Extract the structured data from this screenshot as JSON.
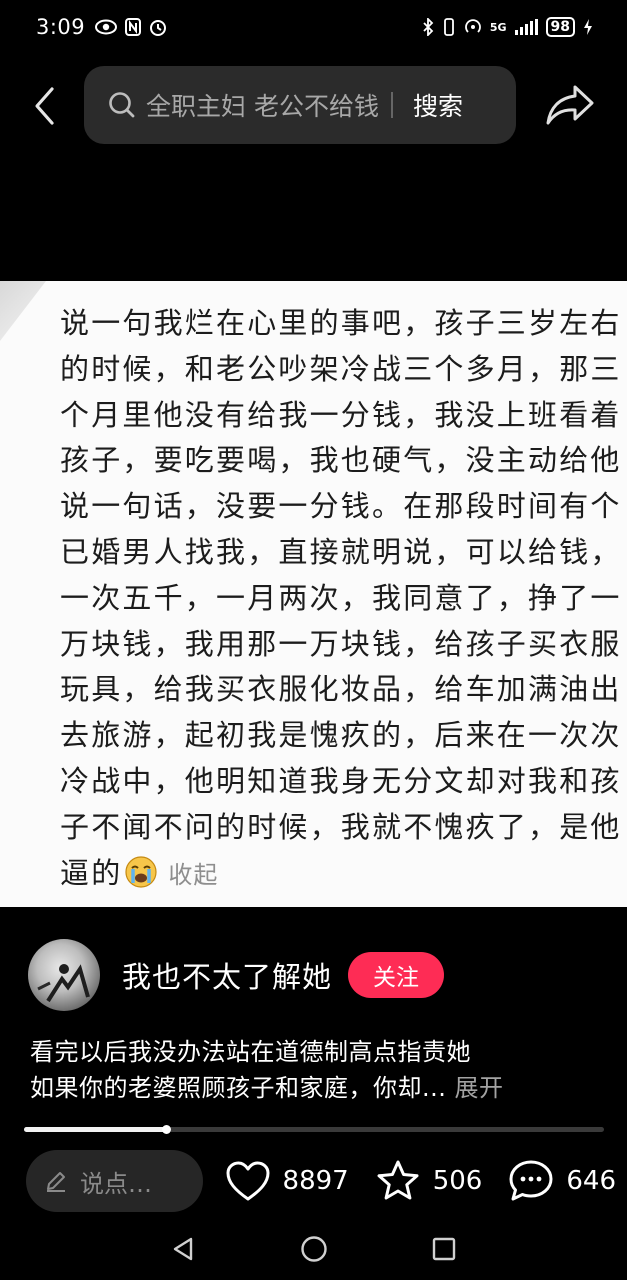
{
  "status_bar": {
    "time": "3:09",
    "network": "5G",
    "battery": "98"
  },
  "search": {
    "query": "全职主妇 老公不给钱",
    "button_label": "搜索"
  },
  "post": {
    "text": "说一句我烂在心里的事吧，孩子三岁左右的时候，和老公吵架冷战三个多月，那三个月里他没有给我一分钱，我没上班看着孩子，要吃要喝，我也硬气，没主动给他说一句话，没要一分钱。在那段时间有个已婚男人找我，直接就明说，可以给钱，一次五千，一月两次，我同意了，挣了一万块钱，我用那一万块钱，给孩子买衣服玩具，给我买衣服化妆品，给车加满油出去旅游，起初我是愧疚的，后来在一次次冷战中，他明知道我身无分文却对我和孩子不闻不问的时候，我就不愧疚了，是他逼的",
    "collapse_label": "收起",
    "emoji": "loudly-crying-face"
  },
  "author": {
    "name": "我也不太了解她",
    "follow_label": "关注"
  },
  "caption": {
    "line1": "看完以后我没办法站在道德制高点指责她",
    "line2": "如果你的老婆照顾孩子和家庭，你却...",
    "expand_label": "展开"
  },
  "progress": {
    "fraction": 0.245
  },
  "actions": {
    "comment_placeholder": "说点…",
    "likes": "8897",
    "favorites": "506",
    "comments": "646"
  },
  "colors": {
    "follow": "#fe2c55",
    "background": "#000000",
    "search_bg": "#2b2b2b"
  }
}
